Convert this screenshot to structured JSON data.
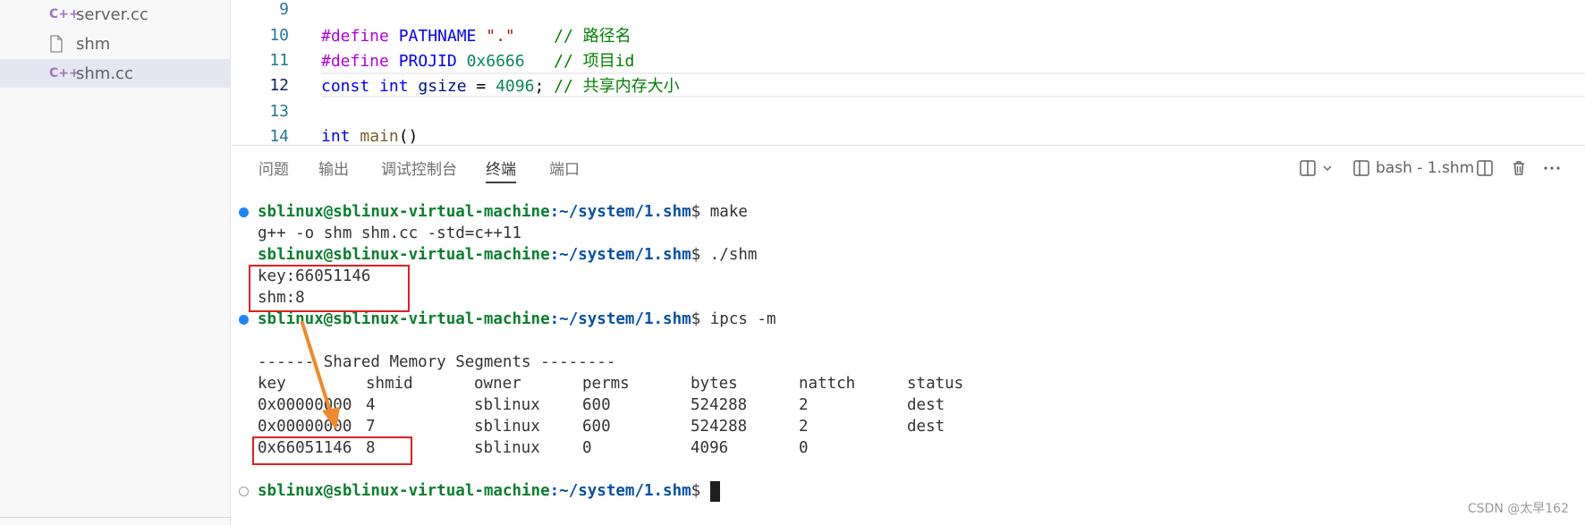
{
  "sidebar": {
    "items": [
      {
        "label": "server.cc",
        "icon": "cpp-icon",
        "badge": "C++",
        "selected": false
      },
      {
        "label": "shm",
        "icon": "file-icon",
        "badge": "",
        "selected": false
      },
      {
        "label": "shm.cc",
        "icon": "cpp-icon",
        "badge": "C++",
        "selected": true
      }
    ]
  },
  "editor": {
    "lines": [
      {
        "num": "9"
      },
      {
        "num": "10",
        "directive": "#define",
        "name": "PATHNAME",
        "value": "\".\"",
        "comment": "// 路径名"
      },
      {
        "num": "11",
        "directive": "#define",
        "name": "PROJID",
        "value": "0x6666",
        "comment": "// 项目id"
      },
      {
        "num": "12",
        "kw1": "const",
        "kw2": "int",
        "var": "gsize",
        "op": " = ",
        "value": "4096",
        "semi": ";",
        "comment": "// 共享内存大小"
      },
      {
        "num": "13"
      },
      {
        "num": "14",
        "kw": "int",
        "fn": "main",
        "paren": "()"
      }
    ]
  },
  "panel": {
    "tabs": [
      {
        "label": "问题",
        "active": false
      },
      {
        "label": "输出",
        "active": false
      },
      {
        "label": "调试控制台",
        "active": false
      },
      {
        "label": "终端",
        "active": true
      },
      {
        "label": "端口",
        "active": false
      }
    ],
    "terminal_name": "bash - 1.shm"
  },
  "terminal": {
    "user_host": "sblinux@sblinux-virtual-machine",
    "path": ":~/system/1.shm",
    "prompt_suffix": "$ ",
    "cmd1": "make",
    "out1": "g++ -o shm shm.cc -std=c++11",
    "cmd2": "./shm",
    "key_line": "key:66051146",
    "shm_line": "shm:8",
    "cmd3": "ipcs -m",
    "segments_header": "------ Shared Memory Segments --------",
    "table": {
      "headers": [
        "key",
        "shmid",
        "owner",
        "perms",
        "bytes",
        "nattch",
        "status"
      ],
      "rows": [
        [
          "0x00000000",
          "4",
          "sblinux",
          "600",
          "524288",
          "2",
          "dest"
        ],
        [
          "0x00000000",
          "7",
          "sblinux",
          "600",
          "524288",
          "2",
          "dest"
        ],
        [
          "0x66051146",
          "8",
          "sblinux",
          "0",
          "4096",
          "0",
          ""
        ]
      ]
    }
  },
  "colors": {
    "accent_red": "#e02020",
    "arrow_orange": "#f08a2b",
    "prompt_green": "#0a7f2e",
    "prompt_blue": "#0451a5"
  },
  "watermark": "CSDN @太早162"
}
